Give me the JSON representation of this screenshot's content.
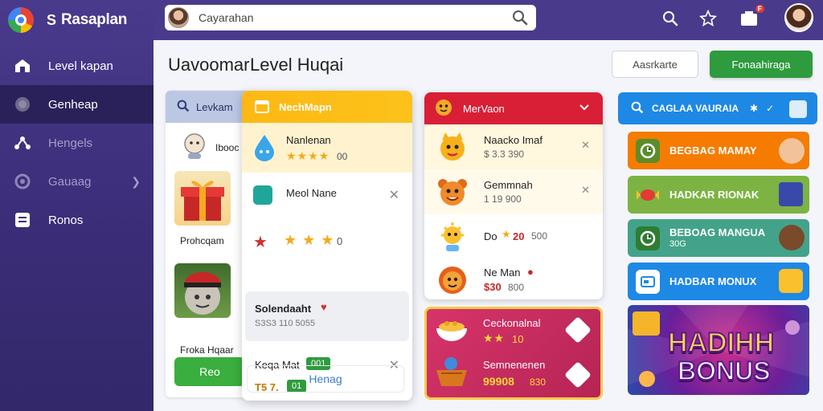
{
  "app": {
    "brand_mark": "S",
    "brand_name": "Rasaplan"
  },
  "search": {
    "placeholder": "Cayarahan"
  },
  "topbar": {
    "notification_count": "F"
  },
  "sidebar": {
    "items": [
      {
        "label": "Level kapan"
      },
      {
        "label": "Genheap"
      },
      {
        "label": "Hengels"
      },
      {
        "label": "Gauaag"
      },
      {
        "label": "Ronos"
      }
    ]
  },
  "page": {
    "title_left": "Uavoomar",
    "title_right": "Level Huqai",
    "outline_button": "Aasrkarte",
    "green_button": "Fonaahiraga"
  },
  "col1": {
    "header": "Levkam",
    "item1": "Ibooc",
    "caption1": "Prohcqam",
    "caption2": "Froka Hqaar",
    "button": "Reo"
  },
  "col2": {
    "header": "NechMapn",
    "row1_title": "Nanlenan",
    "row1_value": "00",
    "row2_title": "Meol Nane",
    "row3_value": "0",
    "row4_title": "Solendaaht",
    "row4_sub": "S3S3 110 5055",
    "row5_title": "Keqa Mat",
    "row5_badge": "001",
    "row6_value": "T5 7.",
    "row6_badge": "01",
    "button": "Henag"
  },
  "col3": {
    "header": "MerVaon",
    "rows": [
      {
        "name": "Naacko Imaf",
        "sub": "$ 3.3 390"
      },
      {
        "name": "Gemmnah",
        "sub": "1 19 900"
      },
      {
        "name": "Do",
        "value": "20",
        "sub": "500"
      },
      {
        "name": "Ne Man",
        "sub": "$30",
        "sub2": "800"
      }
    ],
    "promo": [
      {
        "name": "Ceckonalnal",
        "value": "10"
      },
      {
        "name": "Semnenenen",
        "value": "99908",
        "value2": "830"
      }
    ]
  },
  "col4": {
    "header": "CAGLAA VAURAIA",
    "cards": [
      {
        "label": "BEGBAG MAMAY",
        "color": "#f57c00"
      },
      {
        "label": "HADKAR RIONAK",
        "color": "#7cb342"
      },
      {
        "label": "BEBOAG MANGUA",
        "sub": "30G",
        "color": "#43a38a"
      },
      {
        "label": "HADBAR MONUX",
        "color": "#1e88e5"
      }
    ],
    "banner_line1": "HADIHH",
    "banner_line2": "BONUS"
  }
}
